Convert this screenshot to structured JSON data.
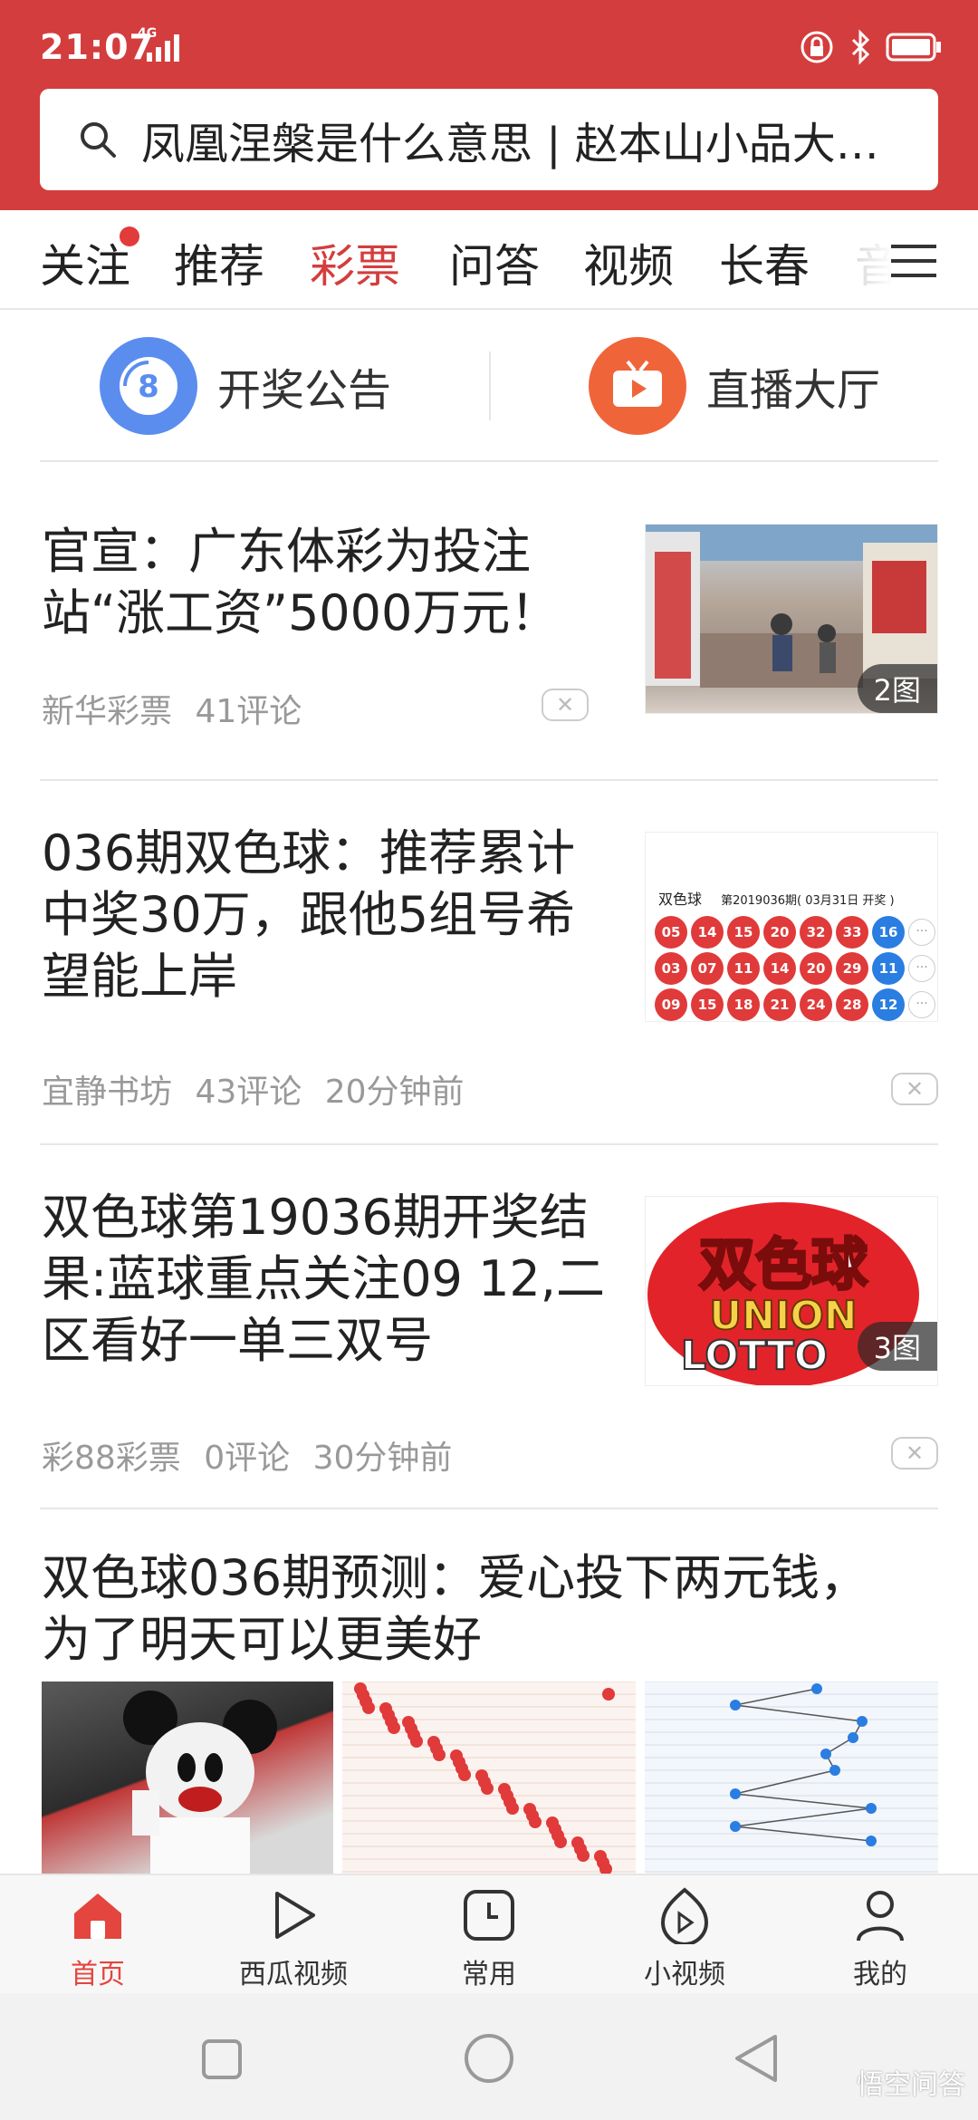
{
  "status_bar": {
    "time": "21:07",
    "network": "4G"
  },
  "search": {
    "query": "凤凰涅槃是什么意思 | 赵本山小品大…"
  },
  "tabs": [
    {
      "label": "关注"
    },
    {
      "label": "推荐"
    },
    {
      "label": "彩票"
    },
    {
      "label": "问答"
    },
    {
      "label": "视频"
    },
    {
      "label": "长春"
    },
    {
      "label": "音"
    }
  ],
  "active_tab": "彩票",
  "quick_links": [
    {
      "label": "开奖公告",
      "icon": "ball-8-icon",
      "color": "#5b8def",
      "icon_text": "8"
    },
    {
      "label": "直播大厅",
      "icon": "tv-icon",
      "color": "#f0643a"
    }
  ],
  "articles": [
    {
      "title_lines": [
        "官宣：广东体彩为投注",
        "站“涨工资”5000万元！"
      ],
      "source": "新华彩票",
      "comments": "41评论",
      "time": "",
      "image_badge": "2图"
    },
    {
      "title_lines": [
        "036期双色球：推荐累计",
        "中奖30万，跟他5组号希",
        "望能上岸"
      ],
      "source": "宜静书坊",
      "comments": "43评论",
      "time": "20分钟前",
      "image": {
        "name": "双色球",
        "issue": "第2019036期( 03月31日 开奖 )",
        "rows": [
          [
            "05",
            "14",
            "15",
            "20",
            "32",
            "33",
            "16"
          ],
          [
            "03",
            "07",
            "11",
            "14",
            "20",
            "29",
            "11"
          ],
          [
            "09",
            "15",
            "18",
            "21",
            "24",
            "28",
            "12"
          ]
        ]
      }
    },
    {
      "title_lines": [
        "双色球第19036期开奖结",
        "果:蓝球重点关注09 12,二",
        "区看好一单三双号"
      ],
      "source": "彩88彩票",
      "comments": "0评论",
      "time": "30分钟前",
      "image_badge": "3图",
      "image": {
        "logo_cn": "双色球",
        "logo_en_1": "UNION",
        "logo_en_2": "LOTTO"
      }
    },
    {
      "title_lines": [
        "双色球036期预测：爱心投下两元钱，",
        "为了明天可以更美好"
      ]
    }
  ],
  "tabbar": [
    {
      "label": "首页",
      "icon": "home-icon",
      "active": true
    },
    {
      "label": "西瓜视频",
      "icon": "play-icon"
    },
    {
      "label": "常用",
      "icon": "clock-icon"
    },
    {
      "label": "小视频",
      "icon": "short-video-icon"
    },
    {
      "label": "我的",
      "icon": "person-icon"
    }
  ],
  "watermark": "悟空问答",
  "colors": {
    "brand_red": "#d43d3d",
    "active_tab": "#e4453f",
    "blue_ball": "#2a7de1",
    "red_ball": "#e03a3a"
  }
}
